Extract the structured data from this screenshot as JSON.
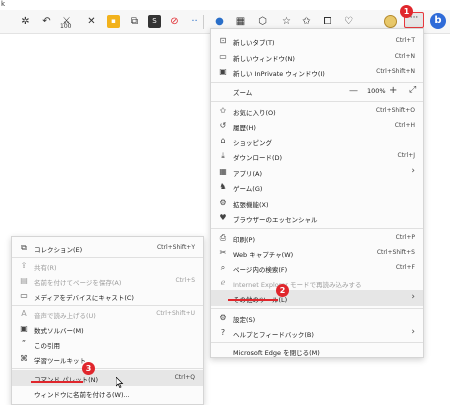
{
  "window_title_fragment": "k",
  "toolbar": {
    "icons": [
      "gear-icon",
      "undo-icon",
      "extension-100-icon",
      "close-x-icon",
      "yellow-square-icon",
      "copy-icon",
      "s-icon",
      "no-icon",
      "blue-dots-icon",
      "collections-icon",
      "grid-icon",
      "shield-icon",
      "star-icon",
      "favorites-icon",
      "tab-icon",
      "heart-icon"
    ],
    "ext_label_100": "100",
    "more_button_label": "···",
    "bing_label": "b"
  },
  "badges": [
    "1",
    "2",
    "3"
  ],
  "main_menu": {
    "items": [
      {
        "label": "新しいタブ(T)",
        "shortcut": "Ctrl+T",
        "icon": "new-tab-icon"
      },
      {
        "label": "新しいウィンドウ(N)",
        "shortcut": "Ctrl+N",
        "icon": "new-window-icon"
      },
      {
        "label": "新しい InPrivate ウィンドウ(I)",
        "shortcut": "Ctrl+Shift+N",
        "icon": "inprivate-icon"
      },
      {
        "label": "ズーム",
        "shortcut": "",
        "icon": ""
      },
      {
        "label": "お気に入り(O)",
        "shortcut": "Ctrl+Shift+O",
        "icon": "favorites-icon"
      },
      {
        "label": "履歴(H)",
        "shortcut": "Ctrl+H",
        "icon": "history-icon"
      },
      {
        "label": "ショッピング",
        "shortcut": "",
        "icon": "shopping-icon"
      },
      {
        "label": "ダウンロード(D)",
        "shortcut": "Ctrl+J",
        "icon": "download-icon"
      },
      {
        "label": "アプリ(A)",
        "shortcut": "",
        "icon": "apps-icon"
      },
      {
        "label": "ゲーム(G)",
        "shortcut": "",
        "icon": "games-icon"
      },
      {
        "label": "拡張機能(X)",
        "shortcut": "",
        "icon": "extensions-icon"
      },
      {
        "label": "ブラウザーのエッセンシャル",
        "shortcut": "",
        "icon": "essentials-icon"
      },
      {
        "label": "印刷(P)",
        "shortcut": "Ctrl+P",
        "icon": "print-icon"
      },
      {
        "label": "Web キャプチャ(W)",
        "shortcut": "Ctrl+Shift+S",
        "icon": "capture-icon"
      },
      {
        "label": "ページ内の検索(F)",
        "shortcut": "Ctrl+F",
        "icon": "find-icon"
      },
      {
        "label": "Internet Explorer モードで再読み込みする",
        "shortcut": "",
        "icon": "ie-icon"
      },
      {
        "label": "その他のツール(L)",
        "shortcut": "",
        "icon": ""
      },
      {
        "label": "設定(S)",
        "shortcut": "",
        "icon": "settings-icon"
      },
      {
        "label": "ヘルプとフィードバック(B)",
        "shortcut": "",
        "icon": "help-icon"
      },
      {
        "label": "Microsoft Edge を閉じる(M)",
        "shortcut": "",
        "icon": ""
      }
    ],
    "zoom_value": "100%",
    "zoom_minus": "—",
    "zoom_plus": "+",
    "zoom_fullscreen": "⤢"
  },
  "sub_menu": {
    "items": [
      {
        "label": "コレクション(E)",
        "shortcut": "Ctrl+Shift+Y",
        "icon": "collections-icon"
      },
      {
        "label": "共有(R)",
        "shortcut": "",
        "icon": "share-icon"
      },
      {
        "label": "名前を付けてページを保存(A)",
        "shortcut": "Ctrl+S",
        "icon": "save-icon"
      },
      {
        "label": "メディアをデバイスにキャスト(C)",
        "shortcut": "",
        "icon": "cast-icon"
      },
      {
        "label": "音声で読み上げる(U)",
        "shortcut": "Ctrl+Shift+U",
        "icon": "read-aloud-icon"
      },
      {
        "label": "数式ソルバー(M)",
        "shortcut": "",
        "icon": "math-solver-icon"
      },
      {
        "label": "この引用",
        "shortcut": "",
        "icon": "citation-icon"
      },
      {
        "label": "学習ツールキット",
        "shortcut": "",
        "icon": "learning-icon"
      },
      {
        "label": "コマンド パレット(N)",
        "shortcut": "Ctrl+Q",
        "icon": ""
      },
      {
        "label": "ウィンドウに名前を付ける(W)...",
        "shortcut": "",
        "icon": ""
      }
    ]
  },
  "colors": {
    "accent_red": "#e0262c",
    "menu_bg": "#fbfbfb",
    "highlight": "#e6e6e6"
  }
}
